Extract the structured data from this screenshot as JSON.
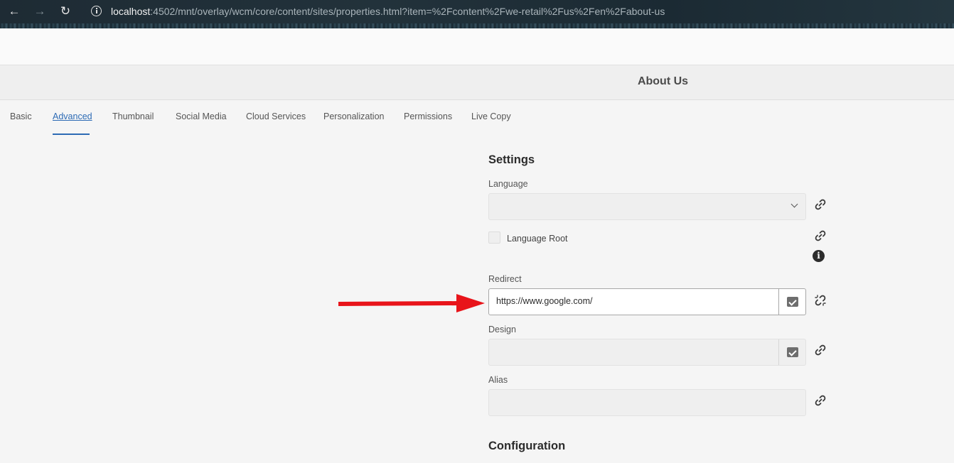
{
  "browser": {
    "url_host": "localhost",
    "url_rest": ":4502/mnt/overlay/wcm/core/content/sites/properties.html?item=%2Fcontent%2Fwe-retail%2Fus%2Fen%2Fabout-us"
  },
  "page": {
    "title": "About Us"
  },
  "tabs": [
    {
      "label": "Basic",
      "active": false
    },
    {
      "label": "Advanced",
      "active": true
    },
    {
      "label": "Thumbnail",
      "active": false
    },
    {
      "label": "Social Media",
      "active": false
    },
    {
      "label": "Cloud Services",
      "active": false
    },
    {
      "label": "Personalization",
      "active": false
    },
    {
      "label": "Permissions",
      "active": false
    },
    {
      "label": "Live Copy",
      "active": false
    }
  ],
  "settings": {
    "heading": "Settings",
    "language": {
      "label": "Language",
      "value": ""
    },
    "language_root": {
      "label": "Language Root",
      "checked": false
    },
    "redirect": {
      "label": "Redirect",
      "value": "https://www.google.com/"
    },
    "design": {
      "label": "Design",
      "value": ""
    },
    "alias": {
      "label": "Alias",
      "value": ""
    }
  },
  "configuration": {
    "heading": "Configuration"
  },
  "colors": {
    "accent": "#2d6bb5",
    "annotation_arrow": "#e8141a"
  },
  "icons": {
    "back": "arrow-left-icon",
    "forward": "arrow-right-icon",
    "reload": "reload-icon",
    "site_info": "info-icon",
    "inheritance": "link-icon",
    "inheritance_broken": "broken-link-icon",
    "help": "info-circle-icon"
  }
}
